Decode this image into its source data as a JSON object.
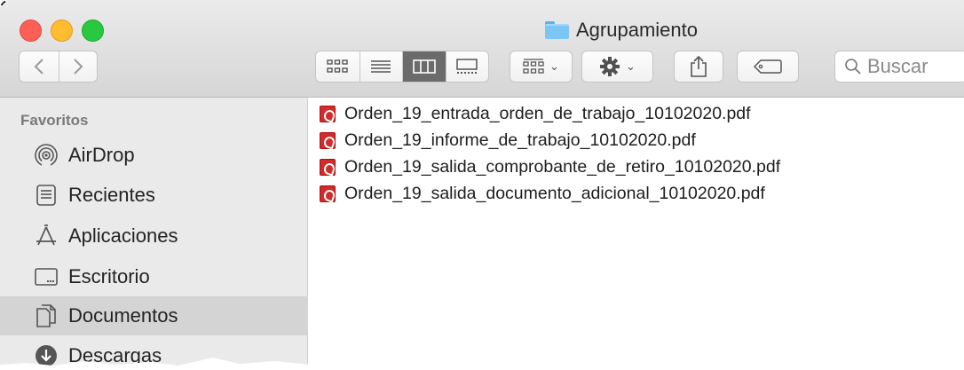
{
  "window": {
    "title": "Agrupamiento",
    "folder_icon": "folder-icon"
  },
  "toolbar": {
    "back_icon": "chevron-left-icon",
    "forward_icon": "chevron-right-icon",
    "view_modes": [
      {
        "name": "icons-view",
        "icon": "grid-icon",
        "active": false
      },
      {
        "name": "list-view",
        "icon": "list-icon",
        "active": false
      },
      {
        "name": "columns-view",
        "icon": "columns-icon",
        "active": true
      },
      {
        "name": "gallery-view",
        "icon": "gallery-icon",
        "active": false
      }
    ],
    "search_placeholder": "Buscar"
  },
  "sidebar": {
    "heading": "Favoritos",
    "items": [
      {
        "label": "AirDrop",
        "icon": "airdrop-icon",
        "selected": false
      },
      {
        "label": "Recientes",
        "icon": "recents-icon",
        "selected": false
      },
      {
        "label": "Aplicaciones",
        "icon": "applications-icon",
        "selected": false
      },
      {
        "label": "Escritorio",
        "icon": "desktop-icon",
        "selected": false
      },
      {
        "label": "Documentos",
        "icon": "documents-icon",
        "selected": true
      },
      {
        "label": "Descargas",
        "icon": "downloads-icon",
        "selected": false
      }
    ]
  },
  "files": [
    {
      "name": "Orden_19_entrada_orden_de_trabajo_10102020.pdf",
      "icon": "pdf-icon"
    },
    {
      "name": "Orden_19_informe_de_trabajo_10102020.pdf",
      "icon": "pdf-icon"
    },
    {
      "name": "Orden_19_salida_comprobante_de_retiro_10102020.pdf",
      "icon": "pdf-icon"
    },
    {
      "name": "Orden_19_salida_documento_adicional_10102020.pdf",
      "icon": "pdf-icon"
    }
  ],
  "colors": {
    "close": "#fe5f57",
    "minimize": "#febc2e",
    "maximize": "#28c840",
    "pdf": "#d32b2b",
    "sidebar_selected": "#d4d4d4"
  }
}
